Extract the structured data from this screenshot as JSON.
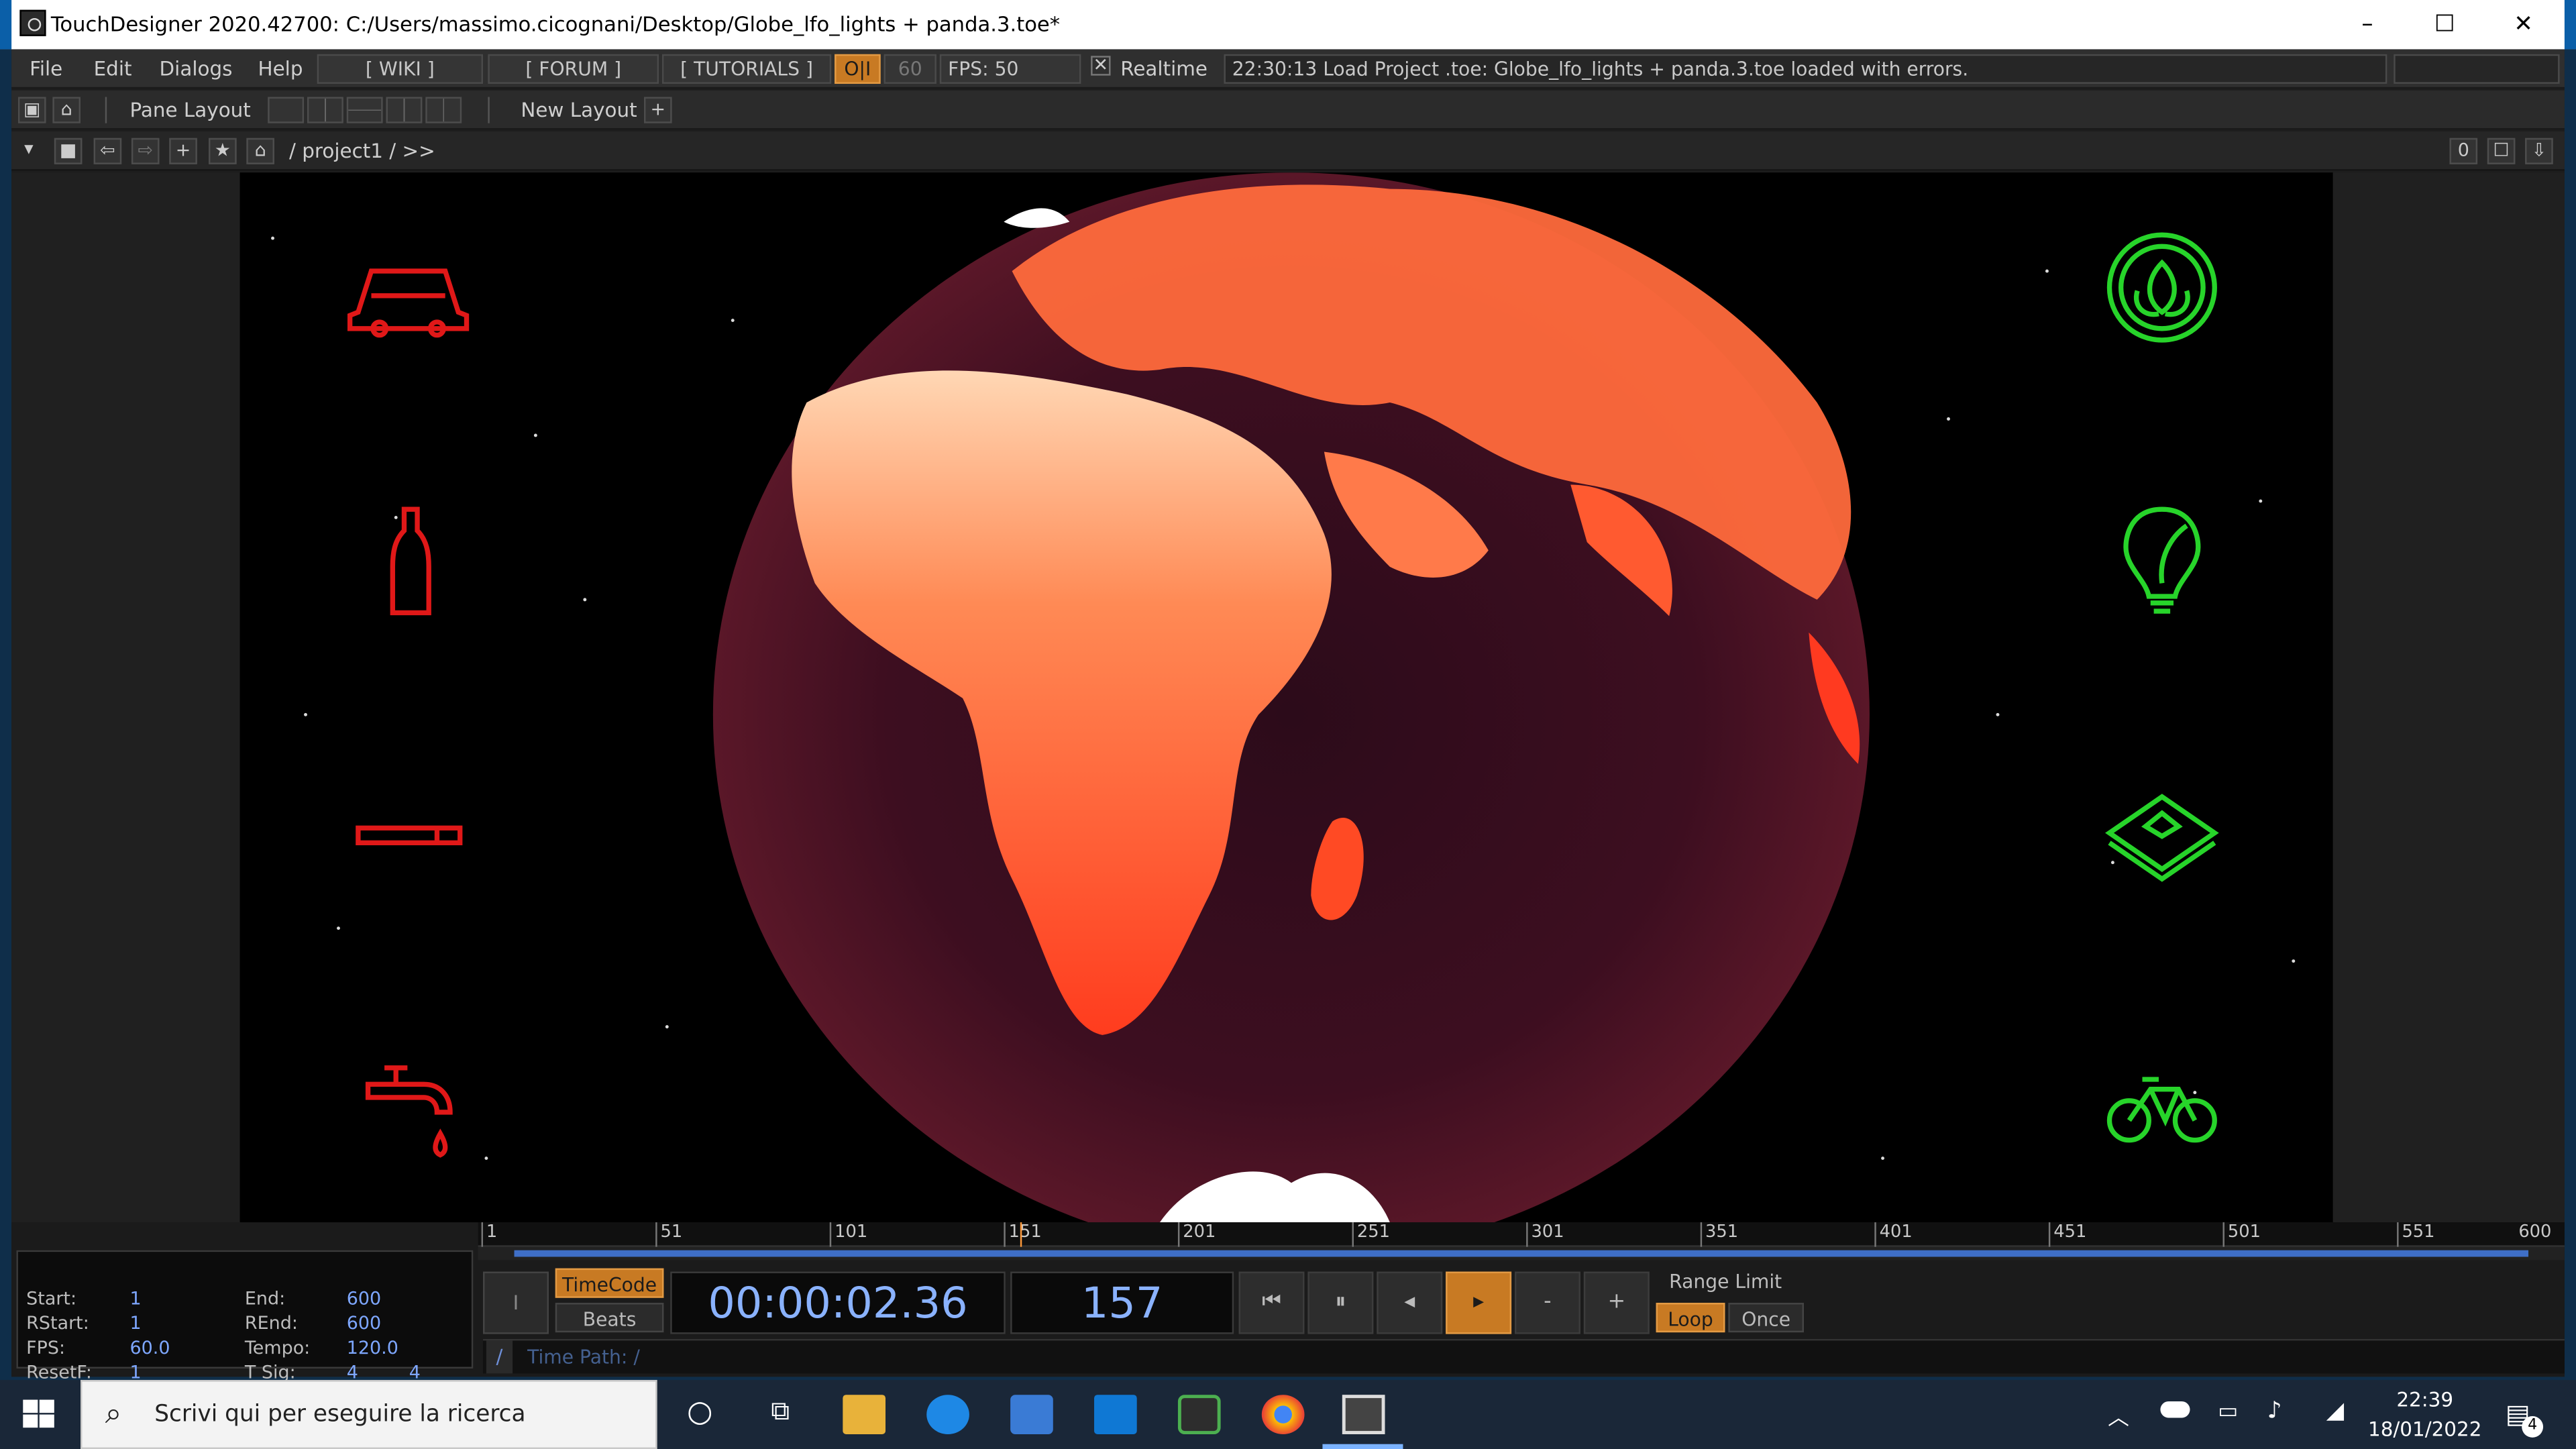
{
  "window": {
    "title": "TouchDesigner 2020.42700: C:/Users/massimo.cicognani/Desktop/Globe_lfo_lights + panda.3.toe*",
    "minimize": "–",
    "maximize": "☐",
    "close": "✕"
  },
  "menu": {
    "file": "File",
    "edit": "Edit",
    "dialogs": "Dialogs",
    "help": "Help",
    "wiki": "[ WIKI ]",
    "forum": "[ FORUM ]",
    "tutorials": "[ TUTORIALS ]",
    "oi": "O|I",
    "sixty": "60",
    "fps": "FPS:  50",
    "realtime_box": "✕",
    "realtime": "Realtime",
    "status": "22:30:13 Load Project .toe: Globe_lfo_lights + panda.3.toe loaded with errors."
  },
  "toolbar2": {
    "pane_layout": "Pane Layout",
    "new_layout": "New Layout",
    "plus": "+"
  },
  "toolbar3": {
    "path": "/ project1 / >>",
    "right_value": "0"
  },
  "icons_left": [
    "car-icon",
    "bottle-icon",
    "cigarette-icon",
    "faucet-icon"
  ],
  "icons_right": [
    "leaf-badge-icon",
    "lightbulb-leaf-icon",
    "recycle-box-icon",
    "bicycle-icon"
  ],
  "colors": {
    "bad_icon": "#e01818",
    "good_icon": "#27d42a",
    "orange_btn": "#c87a23",
    "accent_blue": "#7ea7ff"
  },
  "timeline": {
    "ticks": [
      "1",
      "51",
      "101",
      "151",
      "201",
      "251",
      "301",
      "351",
      "401",
      "451",
      "501",
      "551",
      "600"
    ],
    "info": {
      "start_label": "Start:",
      "start": "1",
      "end_label": "End:",
      "end": "600",
      "rstart_label": "RStart:",
      "rstart": "1",
      "rend_label": "REnd:",
      "rend": "600",
      "fps_label": "FPS:",
      "fps": "60.0",
      "tempo_label": "Tempo:",
      "tempo": "120.0",
      "resetf_label": "ResetF:",
      "resetf": "1",
      "tsig_label": "T Sig:",
      "tsig_a": "4",
      "tsig_b": "4"
    },
    "small_i": "I",
    "timecode": "TimeCode",
    "beats": "Beats",
    "time": "00:00:02.36",
    "frame": "157",
    "btn_first": "⏮",
    "btn_pause": "⏸",
    "btn_back": "◂",
    "btn_play": "▸",
    "btn_minus": "-",
    "btn_plus": "+",
    "range_limit": "Range Limit",
    "loop": "Loop",
    "once": "Once",
    "time_path_slash": "/",
    "time_path": "Time Path: /"
  },
  "taskbar": {
    "search_placeholder": "Scrivi qui per eseguire la ricerca",
    "time": "22:39",
    "date": "18/01/2022",
    "notif_count": "4"
  }
}
